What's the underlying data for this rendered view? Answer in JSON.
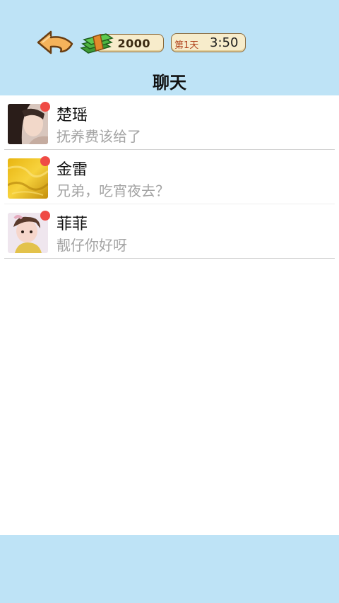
{
  "header": {
    "money": "2000",
    "day": "第1天",
    "time": "3:50",
    "title": "聊天"
  },
  "chats": [
    {
      "name": "楚瑶",
      "preview": "抚养费该给了",
      "unread": true
    },
    {
      "name": "金雷",
      "preview": "兄弟，吃宵夜去？",
      "unread": true
    },
    {
      "name": "菲菲",
      "preview": "靓仔你好呀",
      "unread": true
    }
  ],
  "colors": {
    "topbar_bg": "#bee3f6",
    "badge": "#ef4b45",
    "preview_text": "#a4a4a4"
  },
  "icons": [
    "back-arrow-icon",
    "money-stack-icon"
  ]
}
